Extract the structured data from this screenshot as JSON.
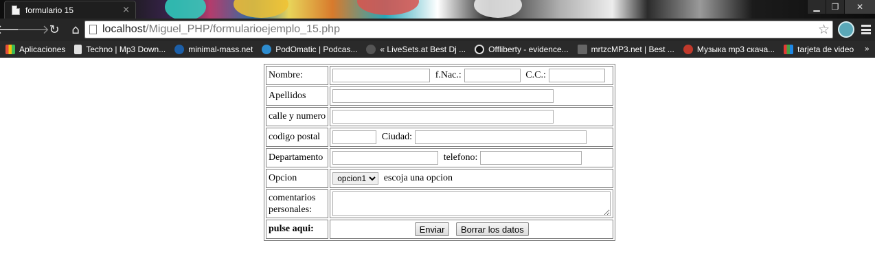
{
  "browser": {
    "tab_title": "formulario 15",
    "tab_close": "×",
    "window_controls": {
      "minimize": "▁",
      "maximize": "❐",
      "close": "✕"
    },
    "url_host": "localhost",
    "url_path": "/Miguel_PHP/formularioejemplo_15.php",
    "nav_icons": {
      "back": "back-arrow-icon",
      "forward": "forward-arrow-icon",
      "reload": "reload-icon",
      "home": "home-icon"
    },
    "bookmarks": [
      {
        "label": "Aplicaciones",
        "icon": "apps-grid-icon",
        "color": "#e44d3a"
      },
      {
        "label": "Techno | Mp3 Down...",
        "icon": "page-icon",
        "color": "#e0e0e0"
      },
      {
        "label": "minimal-mass.net",
        "icon": "dj-icon",
        "color": "#1c5fa8"
      },
      {
        "label": "PodOmatic | Podcas...",
        "icon": "podomatic-icon",
        "color": "#2d8ccf"
      },
      {
        "label": "« LiveSets.at Best Dj ...",
        "icon": "play-icon",
        "color": "#555555"
      },
      {
        "label": "Offliberty - evidence...",
        "icon": "power-icon",
        "color": "#111111"
      },
      {
        "label": "mrtzcMP3.net | Best ...",
        "icon": "m-icon",
        "color": "#666666"
      },
      {
        "label": "Музыка mp3 скача...",
        "icon": "heart-icon",
        "color": "#c0392b"
      },
      {
        "label": "tarjeta de video",
        "icon": "video-card-icon",
        "color": "#3a7bd5"
      }
    ],
    "bookmarks_more": "»"
  },
  "form": {
    "rows": {
      "nombre": {
        "label": "Nombre:",
        "fnac_label": "f.Nac.:",
        "cc_label": "C.C.:"
      },
      "apellidos": {
        "label": "Apellidos"
      },
      "calle": {
        "label": "calle y numero"
      },
      "codigo": {
        "label": "codigo postal",
        "ciudad_label": "Ciudad:"
      },
      "departamento": {
        "label": "Departamento",
        "telefono_label": "telefono:"
      },
      "opcion": {
        "label": "Opcion",
        "selected": "opcion1",
        "hint": "escoja una opcion"
      },
      "comentarios": {
        "label_line1": "comentarios",
        "label_line2": "personales:"
      },
      "submit": {
        "label": "pulse aqui:",
        "send": "Enviar",
        "reset": "Borrar los datos"
      }
    }
  }
}
